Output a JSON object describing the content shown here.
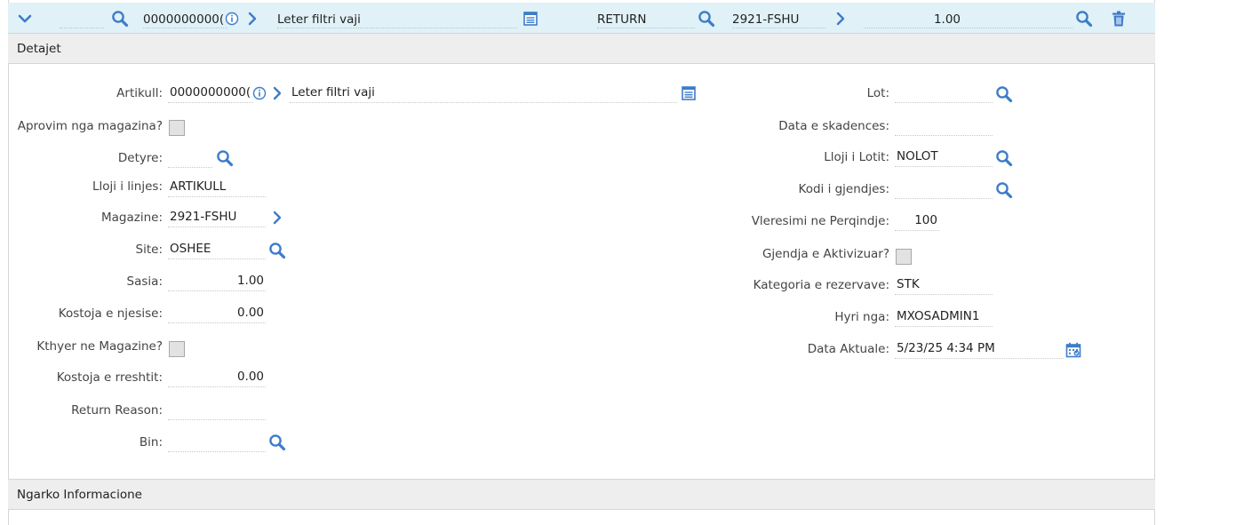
{
  "row": {
    "item_number": "0000000000(",
    "description": "Leter filtri vaji",
    "type": "RETURN",
    "storeroom": "2921-FSHU",
    "quantity": "1.00"
  },
  "details": {
    "title": "Detajet",
    "left_fields": {
      "item": {
        "label": "Artikull:",
        "value": "0000000000(",
        "description": "Leter filtri vaji"
      },
      "approval": {
        "label": "Aprovim nga magazina?"
      },
      "task": {
        "label": "Detyre:",
        "value": ""
      },
      "line_type": {
        "label": "Lloji i linjes:",
        "value": "ARTIKULL"
      },
      "storeroom": {
        "label": "Magazine:",
        "value": "2921-FSHU"
      },
      "site": {
        "label": "Site:",
        "value": "OSHEE"
      },
      "quantity": {
        "label": "Sasia:",
        "value": "1.00"
      },
      "unit_cost": {
        "label": "Kostoja e njesise:",
        "value": "0.00"
      },
      "returned": {
        "label": "Kthyer ne Magazine?"
      },
      "line_cost": {
        "label": "Kostoja e rreshtit:",
        "value": "0.00"
      },
      "return_reason": {
        "label": "Return Reason:",
        "value": ""
      },
      "bin": {
        "label": "Bin:",
        "value": ""
      }
    },
    "right_fields": {
      "lot": {
        "label": "Lot:",
        "value": ""
      },
      "expiry": {
        "label": "Data e skadences:",
        "value": ""
      },
      "lot_type": {
        "label": "Lloji i Lotit:",
        "value": "NOLOT"
      },
      "condition_code": {
        "label": "Kodi i gjendjes:",
        "value": ""
      },
      "percent_rate": {
        "label": "Vleresimi ne Perqindje:",
        "value": "100"
      },
      "condition_enabled": {
        "label": "Gjendja e Aktivizuar?"
      },
      "reserve_category": {
        "label": "Kategoria e rezervave:",
        "value": "STK"
      },
      "entered_by": {
        "label": "Hyri nga:",
        "value": "MXOSADMIN1"
      },
      "actual_date": {
        "label": "Data Aktuale:",
        "value": "5/23/25 4:34 PM"
      }
    }
  },
  "upload": {
    "title": "Ngarko Informacione"
  },
  "colors": {
    "accent": "#3d7cc9",
    "header_bg": "#e0f1f8",
    "section_bg": "#eeeeee"
  },
  "icons": [
    "chevron-down-icon",
    "search-icon",
    "info-icon",
    "chevron-right-icon",
    "long-description-icon",
    "trash-icon",
    "calendar-icon"
  ]
}
